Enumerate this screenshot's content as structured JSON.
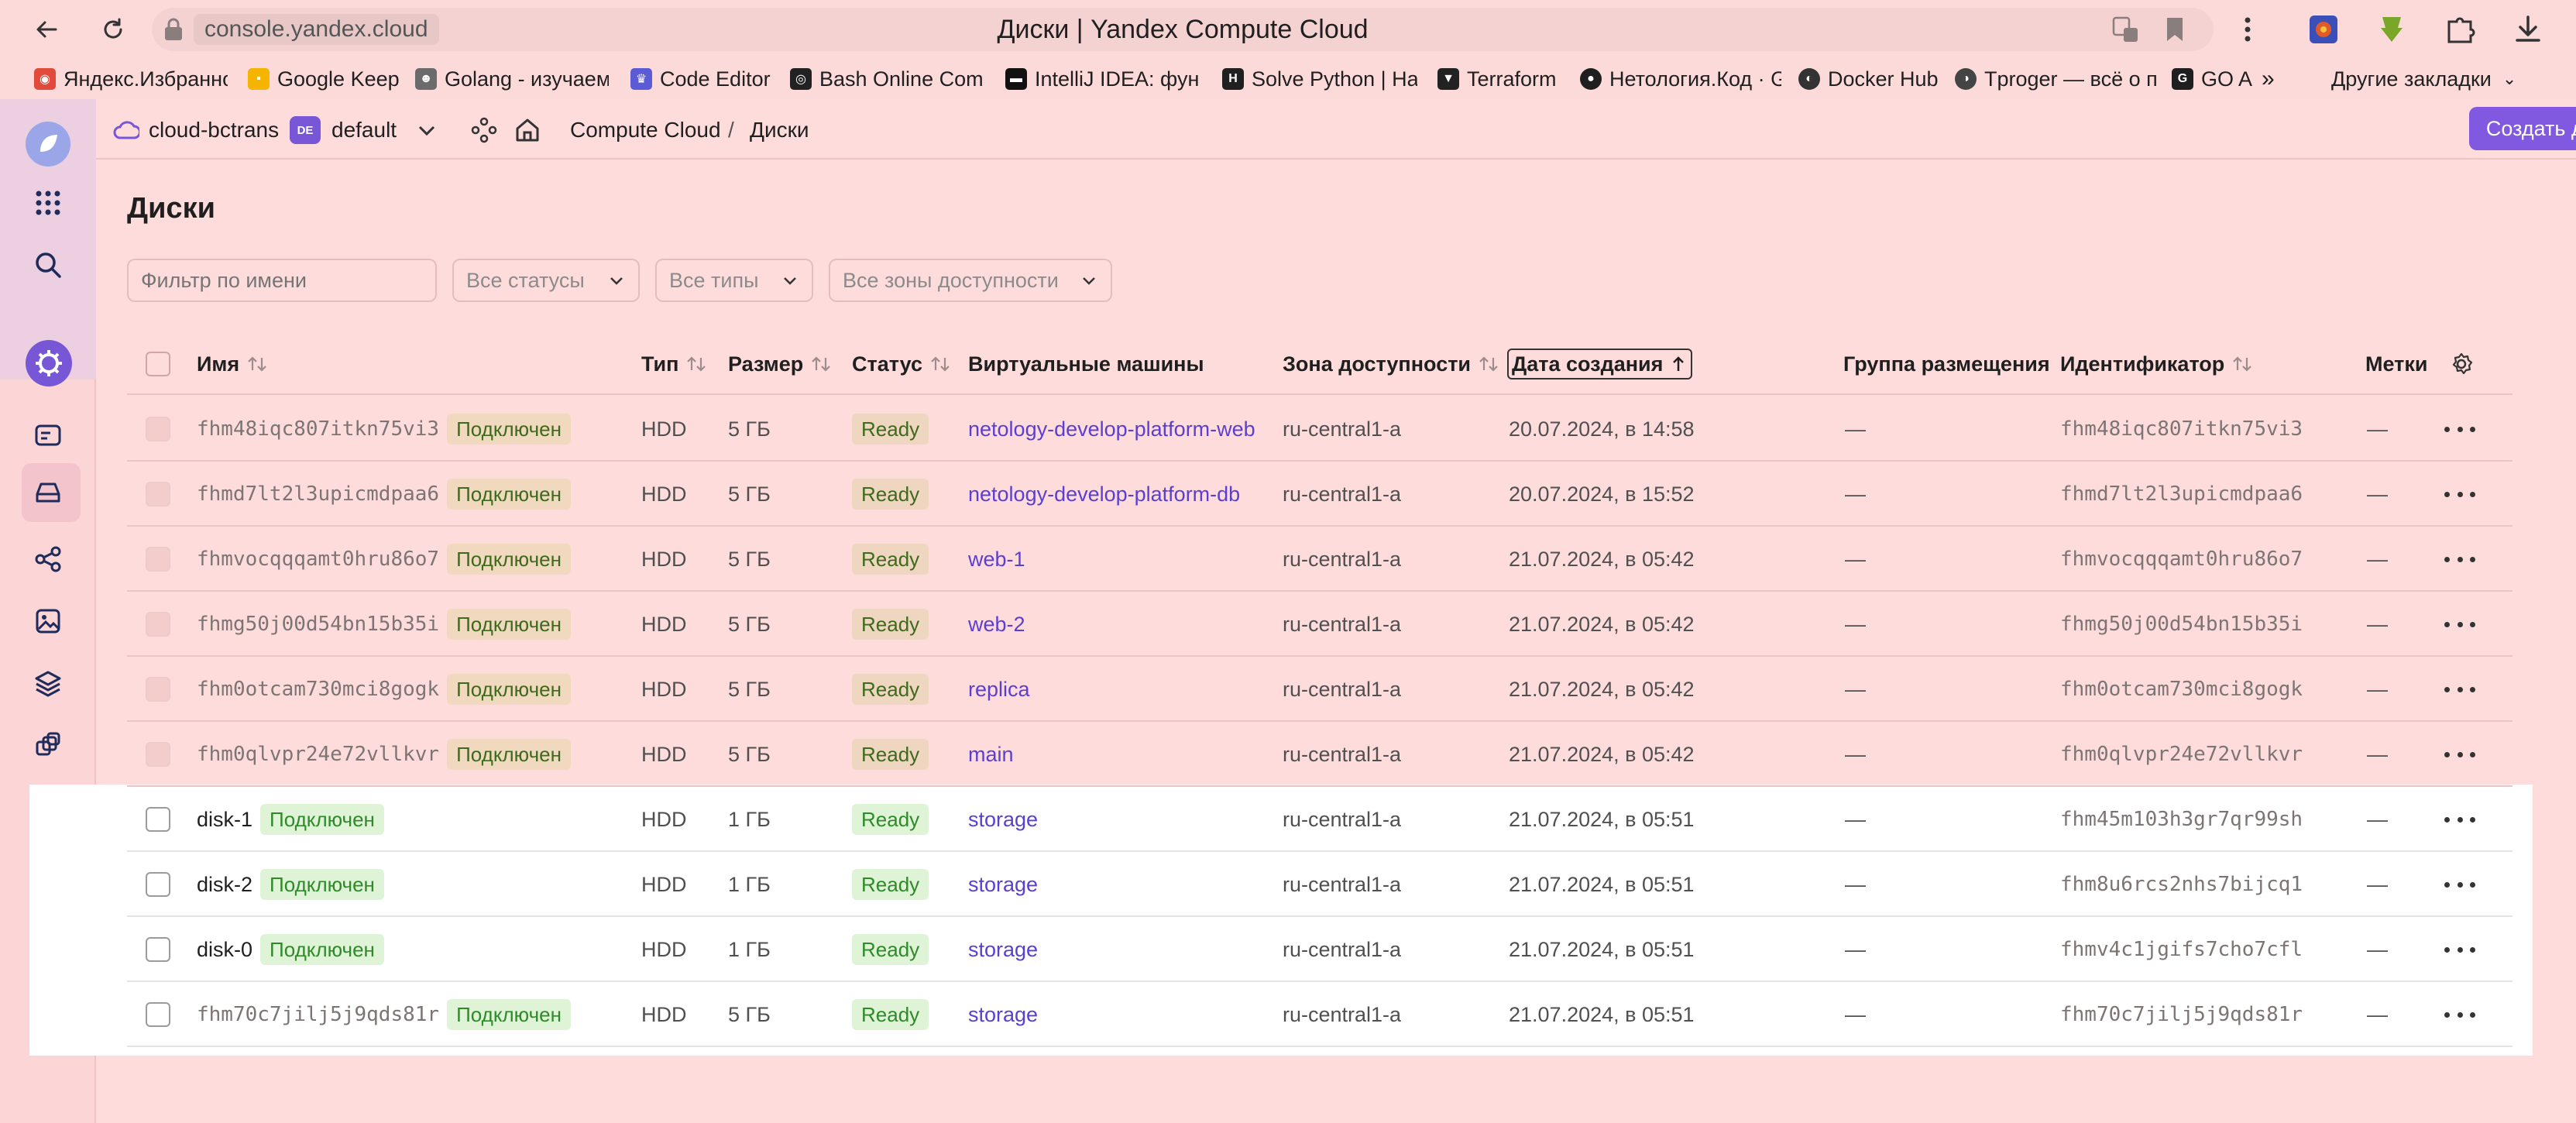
{
  "browser": {
    "url": "console.yandex.cloud",
    "tab_title": "Диски | Yandex Compute Cloud"
  },
  "bookmarks": [
    {
      "label": "Яндекс.Избранно",
      "icon": "yandex-collections-icon",
      "color": "#e24a3b"
    },
    {
      "label": "Google Keep",
      "icon": "google-keep-icon",
      "color": "#f5b400"
    },
    {
      "label": "Golang - изучаем",
      "icon": "golang-icon",
      "color": "#6b6b6b"
    },
    {
      "label": "Code Editor",
      "icon": "code-editor-icon",
      "color": "#5b5bd6"
    },
    {
      "label": "Bash Online Comp",
      "icon": "bash-icon",
      "color": "#222222"
    },
    {
      "label": "IntelliJ IDEA: функ",
      "icon": "intellij-icon",
      "color": "#111111"
    },
    {
      "label": "Solve Python | Hac",
      "icon": "hackerrank-icon",
      "color": "#1f1f1f"
    },
    {
      "label": "Terraform",
      "icon": "terraform-icon",
      "color": "#222222"
    },
    {
      "label": "Нетология.Код · G",
      "icon": "github-icon",
      "color": "#1f1f1f"
    },
    {
      "label": "Docker Hub",
      "icon": "docker-icon",
      "color": "#333333"
    },
    {
      "label": "Tproger — всё о пр",
      "icon": "tproger-icon",
      "color": "#444444"
    },
    {
      "label": "GO A",
      "icon": "go-icon",
      "color": "#1f1f1f"
    }
  ],
  "other_bookmarks": "Другие закладки",
  "header": {
    "cloud": "cloud-bctrans",
    "folder_badge": "DE",
    "folder": "default",
    "breadcrumb_service": "Compute Cloud",
    "breadcrumb_sep": "/",
    "breadcrumb_current": "Диски",
    "create_button": "Создать диск"
  },
  "page": {
    "title": "Диски",
    "filters": {
      "name_placeholder": "Фильтр по имени",
      "status": "Все статусы",
      "type": "Все типы",
      "zone": "Все зоны доступности"
    }
  },
  "table": {
    "columns": {
      "name": "Имя",
      "type": "Тип",
      "size": "Размер",
      "status": "Статус",
      "vms": "Виртуальные машины",
      "zone": "Зона доступности",
      "created": "Дата создания",
      "placement": "Группа размещения",
      "id": "Идентификатор",
      "labels": "Метки"
    },
    "rows": [
      {
        "name": "fhm48iqc807itkn75vi3",
        "mono": true,
        "conn": "Подключен",
        "type": "HDD",
        "size": "5 ГБ",
        "status": "Ready",
        "vm": "netology-develop-platform-web",
        "zone": "ru-central1-a",
        "created": "20.07.2024, в 14:58",
        "placement": "—",
        "id": "fhm48iqc807itkn75vi3",
        "labels": "—"
      },
      {
        "name": "fhmd7lt2l3upicmdpaa6",
        "mono": true,
        "conn": "Подключен",
        "type": "HDD",
        "size": "5 ГБ",
        "status": "Ready",
        "vm": "netology-develop-platform-db",
        "zone": "ru-central1-a",
        "created": "20.07.2024, в 15:52",
        "placement": "—",
        "id": "fhmd7lt2l3upicmdpaa6",
        "labels": "—"
      },
      {
        "name": "fhmvocqqqamt0hru86o7",
        "mono": true,
        "conn": "Подключен",
        "type": "HDD",
        "size": "5 ГБ",
        "status": "Ready",
        "vm": "web-1",
        "zone": "ru-central1-a",
        "created": "21.07.2024, в 05:42",
        "placement": "—",
        "id": "fhmvocqqqamt0hru86o7",
        "labels": "—"
      },
      {
        "name": "fhmg50j00d54bn15b35i",
        "mono": true,
        "conn": "Подключен",
        "type": "HDD",
        "size": "5 ГБ",
        "status": "Ready",
        "vm": "web-2",
        "zone": "ru-central1-a",
        "created": "21.07.2024, в 05:42",
        "placement": "—",
        "id": "fhmg50j00d54bn15b35i",
        "labels": "—"
      },
      {
        "name": "fhm0otcam730mci8gogk",
        "mono": true,
        "conn": "Подключен",
        "type": "HDD",
        "size": "5 ГБ",
        "status": "Ready",
        "vm": "replica",
        "zone": "ru-central1-a",
        "created": "21.07.2024, в 05:42",
        "placement": "—",
        "id": "fhm0otcam730mci8gogk",
        "labels": "—"
      },
      {
        "name": "fhm0qlvpr24e72vllkvr",
        "mono": true,
        "conn": "Подключен",
        "type": "HDD",
        "size": "5 ГБ",
        "status": "Ready",
        "vm": "main",
        "zone": "ru-central1-a",
        "created": "21.07.2024, в 05:42",
        "placement": "—",
        "id": "fhm0qlvpr24e72vllkvr",
        "labels": "—"
      },
      {
        "name": "disk-1",
        "mono": false,
        "conn": "Подключен",
        "type": "HDD",
        "size": "1 ГБ",
        "status": "Ready",
        "vm": "storage",
        "zone": "ru-central1-a",
        "created": "21.07.2024, в 05:51",
        "placement": "—",
        "id": "fhm45m103h3gr7qr99sh",
        "labels": "—"
      },
      {
        "name": "disk-2",
        "mono": false,
        "conn": "Подключен",
        "type": "HDD",
        "size": "1 ГБ",
        "status": "Ready",
        "vm": "storage",
        "zone": "ru-central1-a",
        "created": "21.07.2024, в 05:51",
        "placement": "—",
        "id": "fhm8u6rcs2nhs7bijcq1",
        "labels": "—"
      },
      {
        "name": "disk-0",
        "mono": false,
        "conn": "Подключен",
        "type": "HDD",
        "size": "1 ГБ",
        "status": "Ready",
        "vm": "storage",
        "zone": "ru-central1-a",
        "created": "21.07.2024, в 05:51",
        "placement": "—",
        "id": "fhmv4c1jgifs7cho7cfl",
        "labels": "—"
      },
      {
        "name": "fhm70c7jilj5j9qds81r",
        "mono": true,
        "conn": "Подключен",
        "type": "HDD",
        "size": "5 ГБ",
        "status": "Ready",
        "vm": "storage",
        "zone": "ru-central1-a",
        "created": "21.07.2024, в 05:51",
        "placement": "—",
        "id": "fhm70c7jilj5j9qds81r",
        "labels": "—"
      }
    ]
  },
  "colors": {
    "accent": "#8159e0",
    "link": "#5a3fd0",
    "ready_text": "#2f8a2a",
    "page_bg": "#fedcdc"
  }
}
